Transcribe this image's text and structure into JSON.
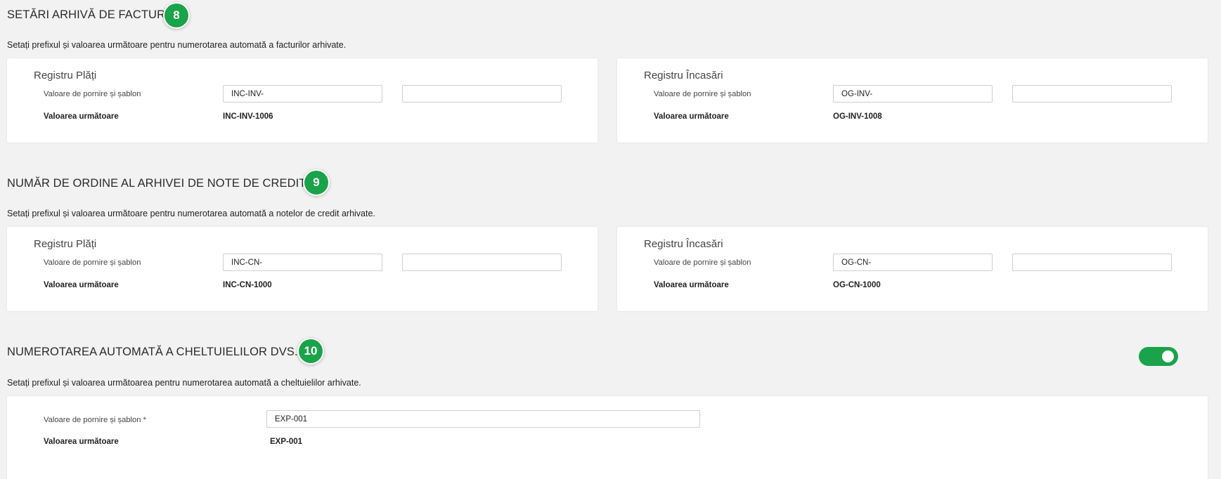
{
  "sections": [
    {
      "title": "SETĂRI ARHIVĂ DE FACTURI",
      "badge": "8",
      "description": "Setați prefixul și valoarea următoare pentru numerotarea automată a facturilor arhivate.",
      "cards": [
        {
          "title": "Registru Plăți",
          "start_label": "Valoare de pornire și șablon",
          "prefix_value": "INC-INV-",
          "suffix_value": "",
          "next_label": "Valoarea următoare",
          "next_value": "INC-INV-1006"
        },
        {
          "title": "Registru Încasări",
          "start_label": "Valoare de pornire și șablon",
          "prefix_value": "OG-INV-",
          "suffix_value": "",
          "next_label": "Valoarea următoare",
          "next_value": "OG-INV-1008"
        }
      ]
    },
    {
      "title": "NUMĂR DE ORDINE AL ARHIVEI DE NOTE DE CREDIT",
      "badge": "9",
      "description": "Setați prefixul și valoarea următoare pentru numerotarea automată a notelor de credit arhivate.",
      "cards": [
        {
          "title": "Registru Plăți",
          "start_label": "Valoare de pornire și șablon",
          "prefix_value": "INC-CN-",
          "suffix_value": "",
          "next_label": "Valoarea următoare",
          "next_value": "INC-CN-1000"
        },
        {
          "title": "Registru Încasări",
          "start_label": "Valoare de pornire și șablon",
          "prefix_value": "OG-CN-",
          "suffix_value": "",
          "next_label": "Valoarea următoare",
          "next_value": "OG-CN-1000"
        }
      ]
    },
    {
      "title": "NUMEROTAREA AUTOMATĂ A CHELTUIELILOR DVS.",
      "badge": "10",
      "description": "Setați prefixul și valoarea următoarea pentru numerotarea automată a cheltuielilor arhivate.",
      "toggle_on": true,
      "card": {
        "start_label": "Valoare de pornire și șablon *",
        "value": "EXP-001",
        "next_label": "Valoarea următoare",
        "next_value": "EXP-001"
      }
    }
  ],
  "colors": {
    "accent": "#1aa34a",
    "background": "#f2f2f2",
    "card": "#ffffff"
  }
}
